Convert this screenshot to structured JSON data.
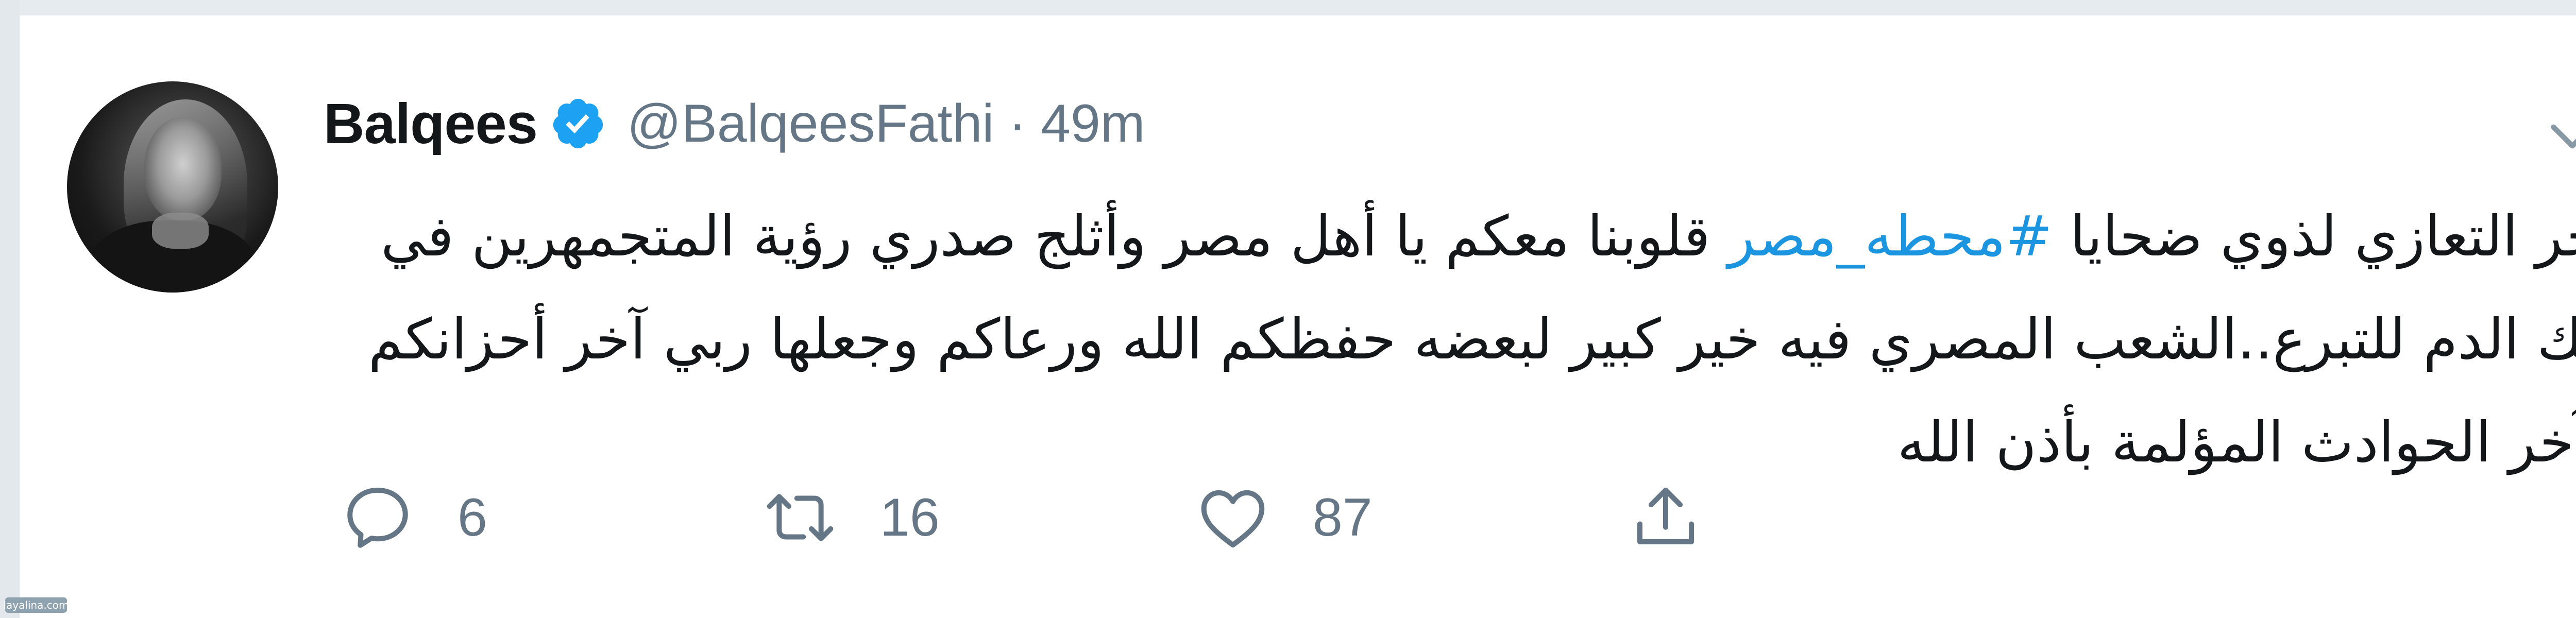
{
  "tweet": {
    "author_name": "Balqees",
    "verified": true,
    "handle": "@BalqeesFathi",
    "separator": "·",
    "time": "49m",
    "text_before": "احر التعازي لذوي ضحايا ",
    "hashtag": "#محطه_مصر",
    "text_after": " قلوبنا معكم يا أهل مصر وأثلج صدري رؤية المتجمهرين في بنك الدم للتبرع..الشعب المصري فيه خير كبير لبعضه حفظكم الله ورعاكم وجعلها ربي آخر أحزانكم وآخر الحوادث المؤلمة بأذن الله",
    "replies": "6",
    "retweets": "16",
    "likes": "87"
  },
  "watermark": "layalina.com",
  "colors": {
    "text": "#14171a",
    "secondary": "#657786",
    "link": "#1b95e0",
    "verified": "#1da1f2",
    "background": "#ffffff"
  },
  "icons": {
    "reply": "reply-icon",
    "retweet": "retweet-icon",
    "like": "heart-icon",
    "share": "share-icon",
    "menu": "chevron-down-icon",
    "verified": "verified-badge-icon"
  }
}
